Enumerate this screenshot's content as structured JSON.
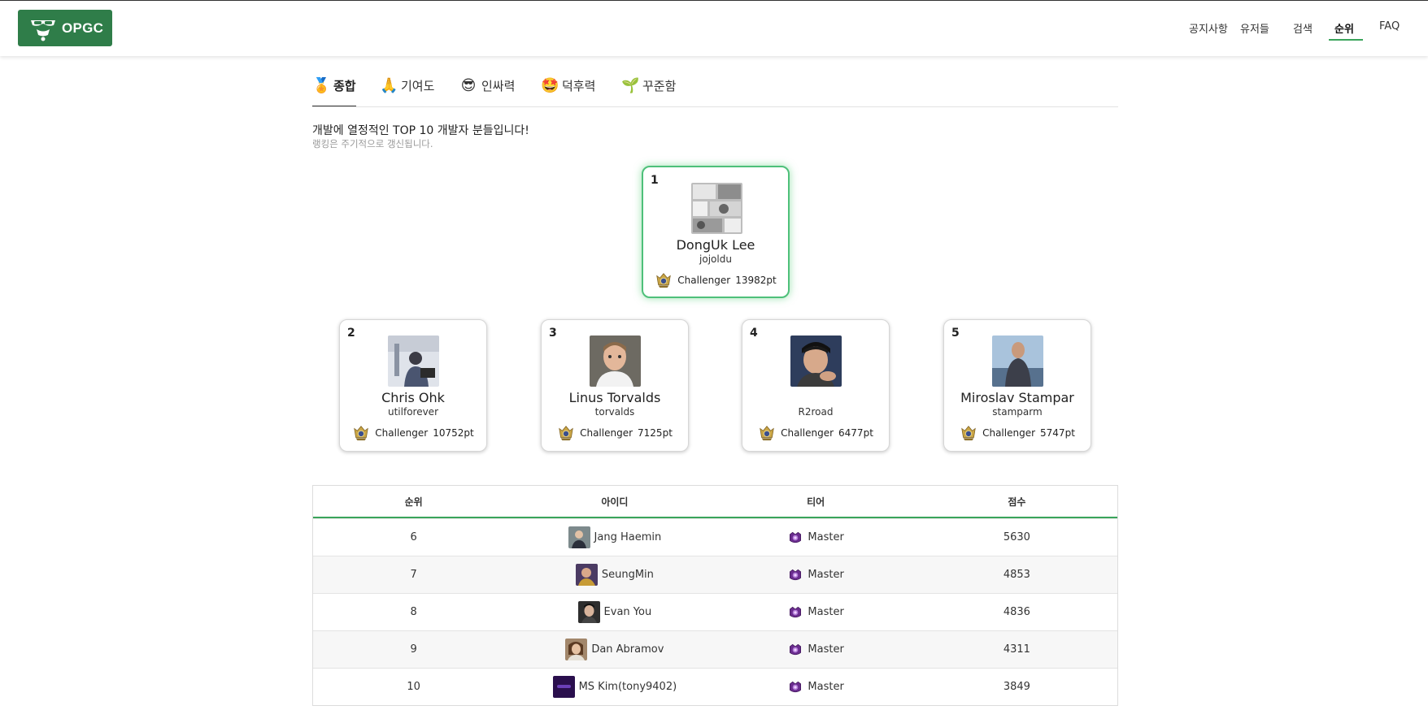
{
  "header": {
    "logo_text": "OPGC",
    "nav": [
      {
        "label": "공지사항"
      },
      {
        "label": "유저들"
      },
      {
        "label": "검색"
      },
      {
        "label": "순위",
        "active": true
      },
      {
        "label": "FAQ"
      }
    ]
  },
  "tabs": [
    {
      "icon": "medal-icon",
      "emoji": "🏅",
      "label": "종합",
      "active": true
    },
    {
      "icon": "folded-hands-icon",
      "emoji": "🙏",
      "label": "기여도"
    },
    {
      "icon": "sunglasses-face-icon",
      "emoji": "😎",
      "label": "인싸력"
    },
    {
      "icon": "star-struck-face-icon",
      "emoji": "🤩",
      "label": "덕후력"
    },
    {
      "icon": "seedling-icon",
      "emoji": "🌱",
      "label": "꾸준함"
    }
  ],
  "intro": {
    "title": "개발에 열정적인 TOP 10 개발자 분들입니다!",
    "subtitle": "랭킹은 주기적으로 갱신됩니다."
  },
  "top5": [
    {
      "rank": "1",
      "name": "DongUk Lee",
      "login": "jojoldu",
      "tier": "Challenger",
      "score": "13982pt"
    },
    {
      "rank": "2",
      "name": "Chris Ohk",
      "login": "utilforever",
      "tier": "Challenger",
      "score": "10752pt"
    },
    {
      "rank": "3",
      "name": "Linus Torvalds",
      "login": "torvalds",
      "tier": "Challenger",
      "score": "7125pt"
    },
    {
      "rank": "4",
      "name": "",
      "login": "R2road",
      "tier": "Challenger",
      "score": "6477pt"
    },
    {
      "rank": "5",
      "name": "Miroslav Stampar",
      "login": "stamparm",
      "tier": "Challenger",
      "score": "5747pt"
    }
  ],
  "table": {
    "headers": [
      "순위",
      "아이디",
      "티어",
      "점수"
    ],
    "rows": [
      {
        "rank": "6",
        "id": "Jang Haemin",
        "tier": "Master",
        "score": "5630"
      },
      {
        "rank": "7",
        "id": "SeungMin",
        "tier": "Master",
        "score": "4853"
      },
      {
        "rank": "8",
        "id": "Evan You",
        "tier": "Master",
        "score": "4836"
      },
      {
        "rank": "9",
        "id": "Dan Abramov",
        "tier": "Master",
        "score": "4311"
      },
      {
        "rank": "10",
        "id": "MS Kim(tony9402)",
        "tier": "Master",
        "score": "3849"
      }
    ]
  },
  "colors": {
    "brand": "#2f7d49",
    "accent": "#3aa45b",
    "first_card_glow": "#4ec07a",
    "master_emblem": "#6a2c8e",
    "challenger_emblem": "#c9a545"
  }
}
